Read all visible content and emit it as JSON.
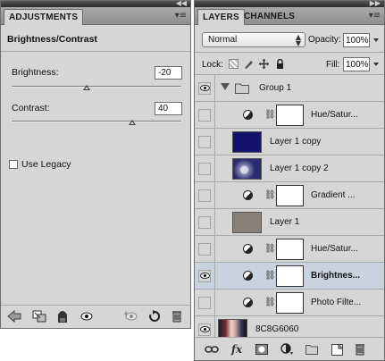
{
  "adjustments": {
    "tab_label": "ADJUSTMENTS",
    "title": "Brightness/Contrast",
    "brightness": {
      "label": "Brightness:",
      "value": "-20",
      "slider_fraction": 0.44
    },
    "contrast": {
      "label": "Contrast:",
      "value": "40",
      "slider_fraction": 0.71
    },
    "legacy_label": "Use Legacy",
    "footer_icons": [
      "back-arrow-icon",
      "clip-to-layer-icon",
      "mask-icon",
      "visibility-eye-icon",
      "view-previous-icon",
      "reset-icon",
      "trash-icon"
    ]
  },
  "layers_panel": {
    "tabs": [
      "LAYERS",
      "CHANNELS"
    ],
    "blend_mode": "Normal",
    "opacity_label": "Opacity:",
    "opacity_value": "100%",
    "lock_label": "Lock:",
    "fill_label": "Fill:",
    "fill_value": "100%",
    "layers": [
      {
        "name": "Group 1",
        "type": "group",
        "visible": true
      },
      {
        "name": "Hue/Satur...",
        "type": "adjustment",
        "visible": false
      },
      {
        "name": "Layer 1 copy",
        "type": "pixel",
        "visible": false,
        "thumb": "#14126a"
      },
      {
        "name": "Layer 1 copy 2",
        "type": "pixel",
        "visible": false,
        "thumb": "#2b2a70"
      },
      {
        "name": "Gradient ...",
        "type": "adjustment",
        "visible": false
      },
      {
        "name": "Layer 1",
        "type": "pixel",
        "visible": false,
        "thumb": "#878078"
      },
      {
        "name": "Hue/Satur...",
        "type": "adjustment",
        "visible": false
      },
      {
        "name": "Brightnes...",
        "type": "adjustment",
        "visible": true,
        "selected": true
      },
      {
        "name": "Photo Filte...",
        "type": "adjustment",
        "visible": false
      },
      {
        "name": "8C8G6060",
        "type": "background",
        "visible": true
      }
    ],
    "footer_icons": [
      "link-layers-icon",
      "fx-icon",
      "add-mask-icon",
      "new-adjustment-icon",
      "new-group-icon",
      "new-layer-icon",
      "trash-icon"
    ],
    "fx_label": "fx"
  },
  "colors": {
    "panel_bg": "#d6d6d6",
    "selected_row": "#c9d2de",
    "tab_bar": "#9b9b9b"
  }
}
